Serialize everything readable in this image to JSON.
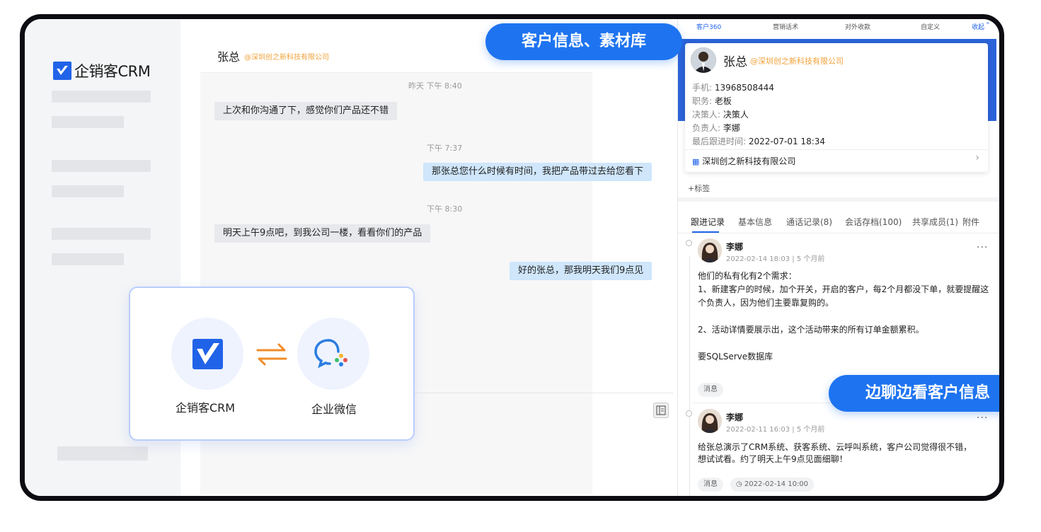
{
  "brand": {
    "name": "企销客CRM",
    "color": "#2163e8"
  },
  "chat": {
    "contact_name": "张总",
    "contact_company": "@深圳创之新科技有限公司",
    "messages": [
      {
        "time": "昨天 下午 8:40",
        "text": "上次和你沟通了下，感觉你们产品还不错",
        "direction": "in"
      },
      {
        "time": "下午 7:37",
        "text": "那张总您什么时候有时间，我把产品带过去给您看下",
        "direction": "out"
      },
      {
        "time": "下午 8:30",
        "text": "明天上午9点吧，到我公司一楼，看看你们的产品",
        "direction": "in"
      },
      {
        "time": "",
        "text": "好的张总，那我明天我们9点见",
        "direction": "out"
      }
    ]
  },
  "integration": {
    "left_label": "企销客CRM",
    "right_label": "企业微信"
  },
  "callouts": {
    "top": "客户信息、素材库",
    "bottom": "边聊边看客户信息"
  },
  "right_panel": {
    "tabs": [
      "客户360",
      "营销话术",
      "对外收款",
      "自定义",
      "收起"
    ],
    "customer": {
      "name": "张总",
      "company_tag": "@深圳创之新科技有限公司",
      "fields": [
        {
          "label": "手机:",
          "value": "13968508444"
        },
        {
          "label": "职务:",
          "value": "老板"
        },
        {
          "label": "决策人:",
          "value": "决策人"
        },
        {
          "label": "负责人:",
          "value": "李娜"
        },
        {
          "label": "最后跟进时间:",
          "value": "2022-07-01 18:34"
        }
      ],
      "company_link": "深圳创之新科技有限公司"
    },
    "add_tag": "+标签",
    "detail_tabs": [
      "跟进记录",
      "基本信息",
      "通话记录(8)",
      "会话存档(100)",
      "共享成员(1)",
      "附件"
    ],
    "records": [
      {
        "author": "李娜",
        "time": "2022-02-14 18:03 | 5 个月前",
        "lines": [
          "他们的私有化有2个需求：",
          "1、新建客户的时候，加个开关，开启的客户，每2个月都没下单，就要提醒这",
          "个负责人，因为他们主要靠复购的。",
          "",
          "2、活动详情要展示出，这个活动带来的所有订单金额累积。",
          "",
          "要SQLServe数据库"
        ],
        "chip": "消息"
      },
      {
        "author": "李娜",
        "time": "2022-02-11 16:03 | 5 个月前",
        "lines": [
          "给张总演示了CRM系统、获客系统、云呼叫系统，客户公司觉得很不错，",
          "想试试看。约了明天上午9点见面细聊！"
        ],
        "chip": "消息",
        "chip2": "2022-02-14 10:00"
      }
    ]
  }
}
